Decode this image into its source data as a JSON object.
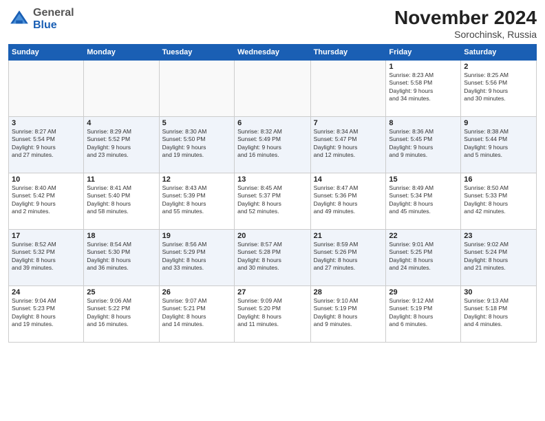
{
  "header": {
    "logo_general": "General",
    "logo_blue": "Blue",
    "month_title": "November 2024",
    "subtitle": "Sorochinsk, Russia"
  },
  "days_of_week": [
    "Sunday",
    "Monday",
    "Tuesday",
    "Wednesday",
    "Thursday",
    "Friday",
    "Saturday"
  ],
  "weeks": [
    {
      "days": [
        {
          "num": "",
          "info": ""
        },
        {
          "num": "",
          "info": ""
        },
        {
          "num": "",
          "info": ""
        },
        {
          "num": "",
          "info": ""
        },
        {
          "num": "",
          "info": ""
        },
        {
          "num": "1",
          "info": "Sunrise: 8:23 AM\nSunset: 5:58 PM\nDaylight: 9 hours\nand 34 minutes."
        },
        {
          "num": "2",
          "info": "Sunrise: 8:25 AM\nSunset: 5:56 PM\nDaylight: 9 hours\nand 30 minutes."
        }
      ]
    },
    {
      "days": [
        {
          "num": "3",
          "info": "Sunrise: 8:27 AM\nSunset: 5:54 PM\nDaylight: 9 hours\nand 27 minutes."
        },
        {
          "num": "4",
          "info": "Sunrise: 8:29 AM\nSunset: 5:52 PM\nDaylight: 9 hours\nand 23 minutes."
        },
        {
          "num": "5",
          "info": "Sunrise: 8:30 AM\nSunset: 5:50 PM\nDaylight: 9 hours\nand 19 minutes."
        },
        {
          "num": "6",
          "info": "Sunrise: 8:32 AM\nSunset: 5:49 PM\nDaylight: 9 hours\nand 16 minutes."
        },
        {
          "num": "7",
          "info": "Sunrise: 8:34 AM\nSunset: 5:47 PM\nDaylight: 9 hours\nand 12 minutes."
        },
        {
          "num": "8",
          "info": "Sunrise: 8:36 AM\nSunset: 5:45 PM\nDaylight: 9 hours\nand 9 minutes."
        },
        {
          "num": "9",
          "info": "Sunrise: 8:38 AM\nSunset: 5:44 PM\nDaylight: 9 hours\nand 5 minutes."
        }
      ]
    },
    {
      "days": [
        {
          "num": "10",
          "info": "Sunrise: 8:40 AM\nSunset: 5:42 PM\nDaylight: 9 hours\nand 2 minutes."
        },
        {
          "num": "11",
          "info": "Sunrise: 8:41 AM\nSunset: 5:40 PM\nDaylight: 8 hours\nand 58 minutes."
        },
        {
          "num": "12",
          "info": "Sunrise: 8:43 AM\nSunset: 5:39 PM\nDaylight: 8 hours\nand 55 minutes."
        },
        {
          "num": "13",
          "info": "Sunrise: 8:45 AM\nSunset: 5:37 PM\nDaylight: 8 hours\nand 52 minutes."
        },
        {
          "num": "14",
          "info": "Sunrise: 8:47 AM\nSunset: 5:36 PM\nDaylight: 8 hours\nand 49 minutes."
        },
        {
          "num": "15",
          "info": "Sunrise: 8:49 AM\nSunset: 5:34 PM\nDaylight: 8 hours\nand 45 minutes."
        },
        {
          "num": "16",
          "info": "Sunrise: 8:50 AM\nSunset: 5:33 PM\nDaylight: 8 hours\nand 42 minutes."
        }
      ]
    },
    {
      "days": [
        {
          "num": "17",
          "info": "Sunrise: 8:52 AM\nSunset: 5:32 PM\nDaylight: 8 hours\nand 39 minutes."
        },
        {
          "num": "18",
          "info": "Sunrise: 8:54 AM\nSunset: 5:30 PM\nDaylight: 8 hours\nand 36 minutes."
        },
        {
          "num": "19",
          "info": "Sunrise: 8:56 AM\nSunset: 5:29 PM\nDaylight: 8 hours\nand 33 minutes."
        },
        {
          "num": "20",
          "info": "Sunrise: 8:57 AM\nSunset: 5:28 PM\nDaylight: 8 hours\nand 30 minutes."
        },
        {
          "num": "21",
          "info": "Sunrise: 8:59 AM\nSunset: 5:26 PM\nDaylight: 8 hours\nand 27 minutes."
        },
        {
          "num": "22",
          "info": "Sunrise: 9:01 AM\nSunset: 5:25 PM\nDaylight: 8 hours\nand 24 minutes."
        },
        {
          "num": "23",
          "info": "Sunrise: 9:02 AM\nSunset: 5:24 PM\nDaylight: 8 hours\nand 21 minutes."
        }
      ]
    },
    {
      "days": [
        {
          "num": "24",
          "info": "Sunrise: 9:04 AM\nSunset: 5:23 PM\nDaylight: 8 hours\nand 19 minutes."
        },
        {
          "num": "25",
          "info": "Sunrise: 9:06 AM\nSunset: 5:22 PM\nDaylight: 8 hours\nand 16 minutes."
        },
        {
          "num": "26",
          "info": "Sunrise: 9:07 AM\nSunset: 5:21 PM\nDaylight: 8 hours\nand 14 minutes."
        },
        {
          "num": "27",
          "info": "Sunrise: 9:09 AM\nSunset: 5:20 PM\nDaylight: 8 hours\nand 11 minutes."
        },
        {
          "num": "28",
          "info": "Sunrise: 9:10 AM\nSunset: 5:19 PM\nDaylight: 8 hours\nand 9 minutes."
        },
        {
          "num": "29",
          "info": "Sunrise: 9:12 AM\nSunset: 5:19 PM\nDaylight: 8 hours\nand 6 minutes."
        },
        {
          "num": "30",
          "info": "Sunrise: 9:13 AM\nSunset: 5:18 PM\nDaylight: 8 hours\nand 4 minutes."
        }
      ]
    }
  ]
}
